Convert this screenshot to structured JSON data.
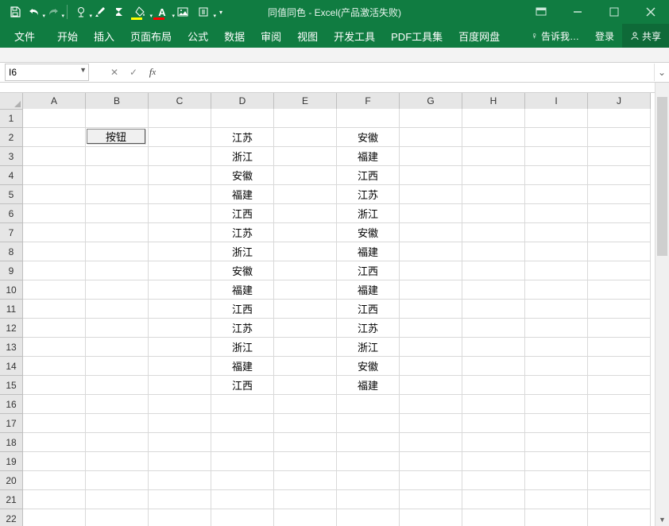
{
  "title": "同值同色 - Excel(产品激活失败)",
  "menu": {
    "tabs": [
      "文件",
      "开始",
      "插入",
      "页面布局",
      "公式",
      "数据",
      "审阅",
      "视图",
      "开发工具",
      "PDF工具集",
      "百度网盘"
    ],
    "tell_me": "告诉我…",
    "signin": "登录",
    "share": "共享"
  },
  "namebox": "I6",
  "formula": "",
  "columns": [
    "A",
    "B",
    "C",
    "D",
    "E",
    "F",
    "G",
    "H",
    "I",
    "J"
  ],
  "row_count": 22,
  "button_label": "按钮",
  "cells": {
    "D2": "江苏",
    "D3": "浙江",
    "D4": "安徽",
    "D5": "福建",
    "D6": "江西",
    "D7": "江苏",
    "D8": "浙江",
    "D9": "安徽",
    "D10": "福建",
    "D11": "江西",
    "D12": "江苏",
    "D13": "浙江",
    "D14": "福建",
    "D15": "江西",
    "F2": "安徽",
    "F3": "福建",
    "F4": "江西",
    "F5": "江苏",
    "F6": "浙江",
    "F7": "安徽",
    "F8": "福建",
    "F9": "江西",
    "F10": "福建",
    "F11": "江西",
    "F12": "江苏",
    "F13": "浙江",
    "F14": "安徽",
    "F15": "福建"
  }
}
